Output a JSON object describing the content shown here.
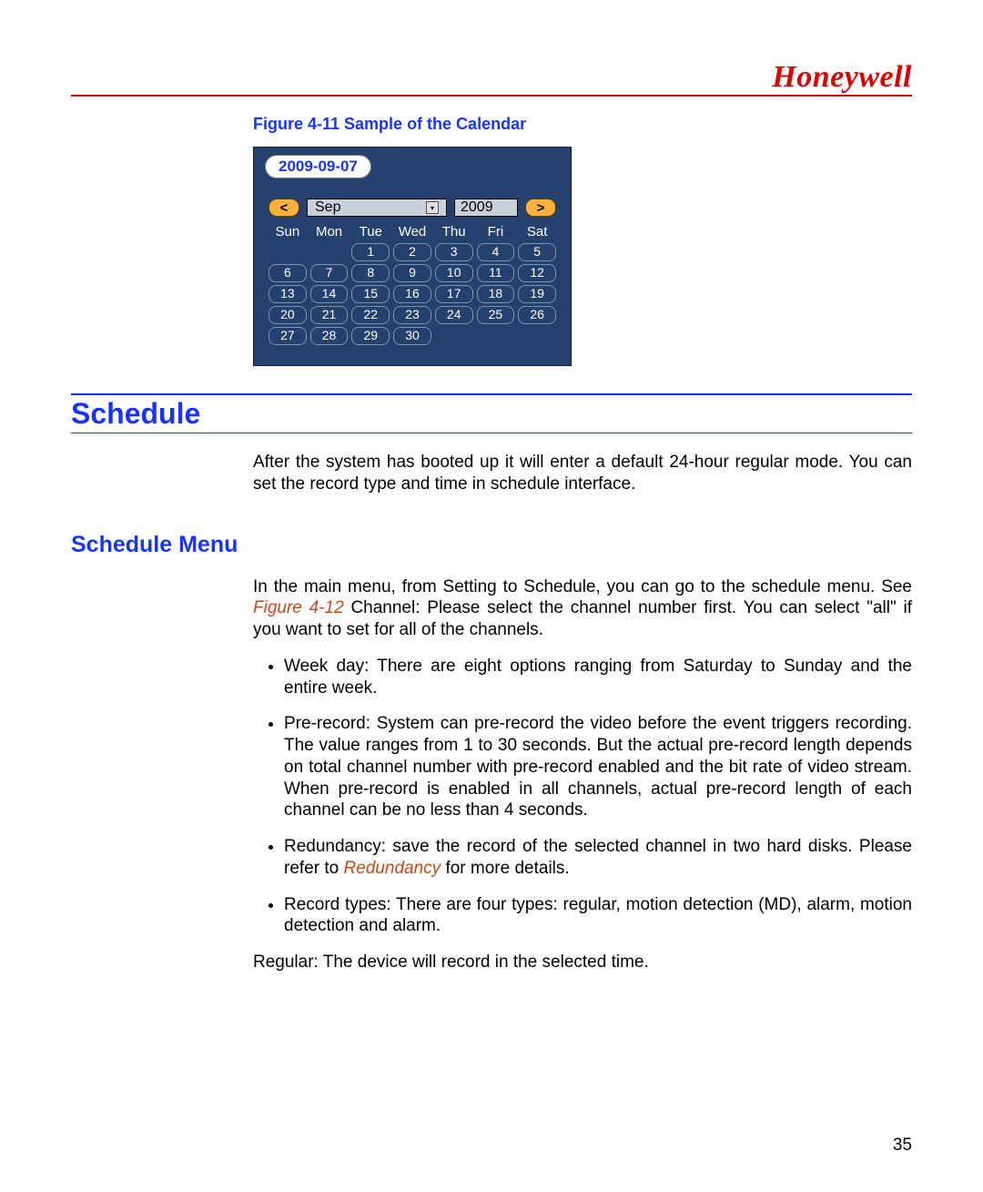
{
  "brand": "Honeywell",
  "figure_caption": "Figure 4-11 Sample of the Calendar",
  "calendar": {
    "selected_date": "2009-09-07",
    "prev": "<",
    "next": ">",
    "month": "Sep",
    "year": "2009",
    "dow": [
      "Sun",
      "Mon",
      "Tue",
      "Wed",
      "Thu",
      "Fri",
      "Sat"
    ],
    "weeks": [
      [
        "",
        "",
        "1",
        "2",
        "3",
        "4",
        "5"
      ],
      [
        "6",
        "7",
        "8",
        "9",
        "10",
        "11",
        "12"
      ],
      [
        "13",
        "14",
        "15",
        "16",
        "17",
        "18",
        "19"
      ],
      [
        "20",
        "21",
        "22",
        "23",
        "24",
        "25",
        "26"
      ],
      [
        "27",
        "28",
        "29",
        "30",
        "",
        "",
        ""
      ]
    ]
  },
  "section_title": "Schedule",
  "intro": "After the system has booted up it will enter a default 24-hour regular mode. You can set the record type and time in schedule interface.",
  "subsection_title": "Schedule Menu",
  "para_lead": "In the main menu, from Setting to Schedule, you can go to the schedule menu. See ",
  "para_ref": "Figure 4-12",
  "para_tail": " Channel: Please select the channel number first. You can select \"all\" if you want to set for all of the channels.",
  "bullets": {
    "b1": "Week day: There are eight options ranging from Saturday to Sunday and the entire week.",
    "b2": "Pre-record: System can pre-record the video before the event triggers recording. The value ranges from 1 to 30 seconds. But the actual pre-record length depends on total channel number with pre-record enabled and the bit rate of video stream. When pre-record is enabled in all channels, actual pre-record length of each channel can be no less than 4 seconds.",
    "b3_lead": "Redundancy: save the record of the selected channel in two hard disks. Please refer to ",
    "b3_ref": "Redundancy",
    "b3_tail": " for more details.",
    "b4": "Record types: There are four types: regular, motion detection (MD), alarm, motion detection and alarm."
  },
  "footer_line": "Regular: The device will record in the selected time.",
  "page_number": "35"
}
